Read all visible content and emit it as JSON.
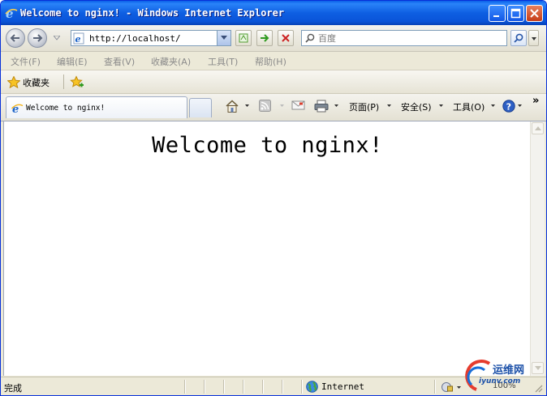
{
  "window": {
    "title": "Welcome to nginx! - Windows Internet Explorer"
  },
  "address_bar": {
    "url": "http://localhost/"
  },
  "search": {
    "placeholder": "百度"
  },
  "menu": {
    "items": [
      {
        "label": "文件(F)"
      },
      {
        "label": "编辑(E)"
      },
      {
        "label": "查看(V)"
      },
      {
        "label": "收藏夹(A)"
      },
      {
        "label": "工具(T)"
      },
      {
        "label": "帮助(H)"
      }
    ]
  },
  "favorites_bar": {
    "label": "收藏夹"
  },
  "tabs": [
    {
      "title": "Welcome to nginx!",
      "active": true
    }
  ],
  "command_bar": {
    "page": "页面(P)",
    "safety": "安全(S)",
    "tools": "工具(O)",
    "overflow": "»"
  },
  "page": {
    "heading": "Welcome to nginx!"
  },
  "status_bar": {
    "text": "完成",
    "zone": "Internet",
    "zoom": "100%"
  },
  "watermark": {
    "text": "运维网",
    "sub": "iyunv.com"
  },
  "colors": {
    "titlebar": "#0a54d8",
    "accent": "#0831d9",
    "close": "#c63c17"
  }
}
